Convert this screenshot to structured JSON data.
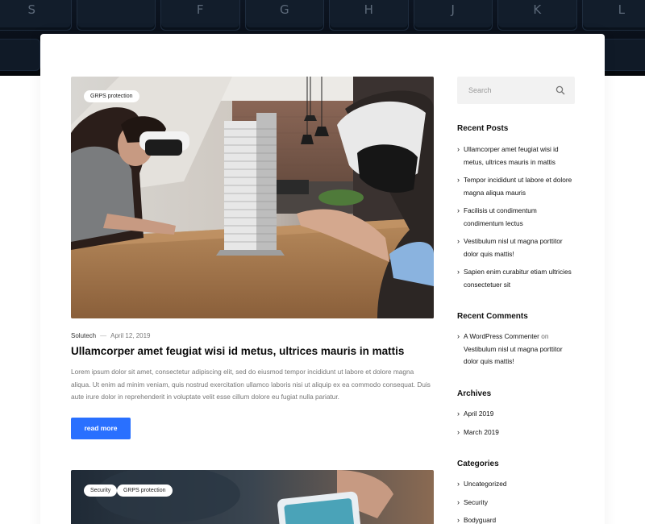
{
  "header_keys": [
    "S",
    "F",
    "G",
    "H",
    "J",
    "K",
    "L"
  ],
  "post1": {
    "badges": [
      "GRPS protection"
    ],
    "author": "Solutech",
    "separator": "—",
    "date": "April 12, 2019",
    "title": "Ullamcorper amet feugiat wisi id metus, ultrices mauris in mattis",
    "excerpt": "Lorem ipsum dolor sit amet, consectetur adipiscing elit, sed do eiusmod tempor incididunt ut labore et dolore magna aliqua. Ut enim ad minim veniam, quis nostrud exercitation ullamco laboris nisi ut aliquip ex ea commodo consequat. Duis aute irure dolor in reprehenderit in voluptate velit esse cillum dolore eu fugiat nulla pariatur.",
    "read_more": "read more"
  },
  "post2": {
    "badges": [
      "Security",
      "GRPS protection"
    ]
  },
  "sidebar": {
    "search_placeholder": "Search",
    "recent_posts_title": "Recent Posts",
    "recent_posts": [
      "Ullamcorper amet feugiat wisi id metus, ultrices mauris in mattis",
      "Tempor incididunt ut labore et dolore magna aliqua mauris",
      "Facilisis ut condimentum condimentum lectus",
      "Vestibulum nisl ut magna porttitor dolor quis mattis!",
      "Sapien enim curabitur etiam ultricies consectetuer sit"
    ],
    "recent_comments_title": "Recent Comments",
    "recent_comment": {
      "author": "A WordPress Commenter",
      "on": "on",
      "post": "Vestibulum nisl ut magna porttitor dolor quis mattis!"
    },
    "archives_title": "Archives",
    "archives": [
      "April 2019",
      "March 2019"
    ],
    "categories_title": "Categories",
    "categories": [
      "Uncategorized",
      "Security",
      "Bodyguard"
    ]
  },
  "colors": {
    "accent": "#2970ff",
    "header_dark": "#0a0f18",
    "search_bg": "#f2f2f2"
  }
}
